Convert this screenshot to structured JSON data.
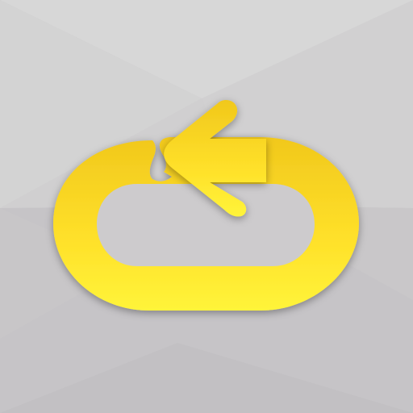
{
  "app_icon": {
    "name": "loop-repeat",
    "icon": "loop-arrow-icon",
    "colors": {
      "icon_fill_light": "#fff033",
      "icon_fill_mid": "#ffe01e",
      "icon_fill_dark": "#f5cb16",
      "background_light": "#d8d8d8",
      "background_mid": "#cfcdcf",
      "background_dark": "#bdbbbe"
    }
  }
}
